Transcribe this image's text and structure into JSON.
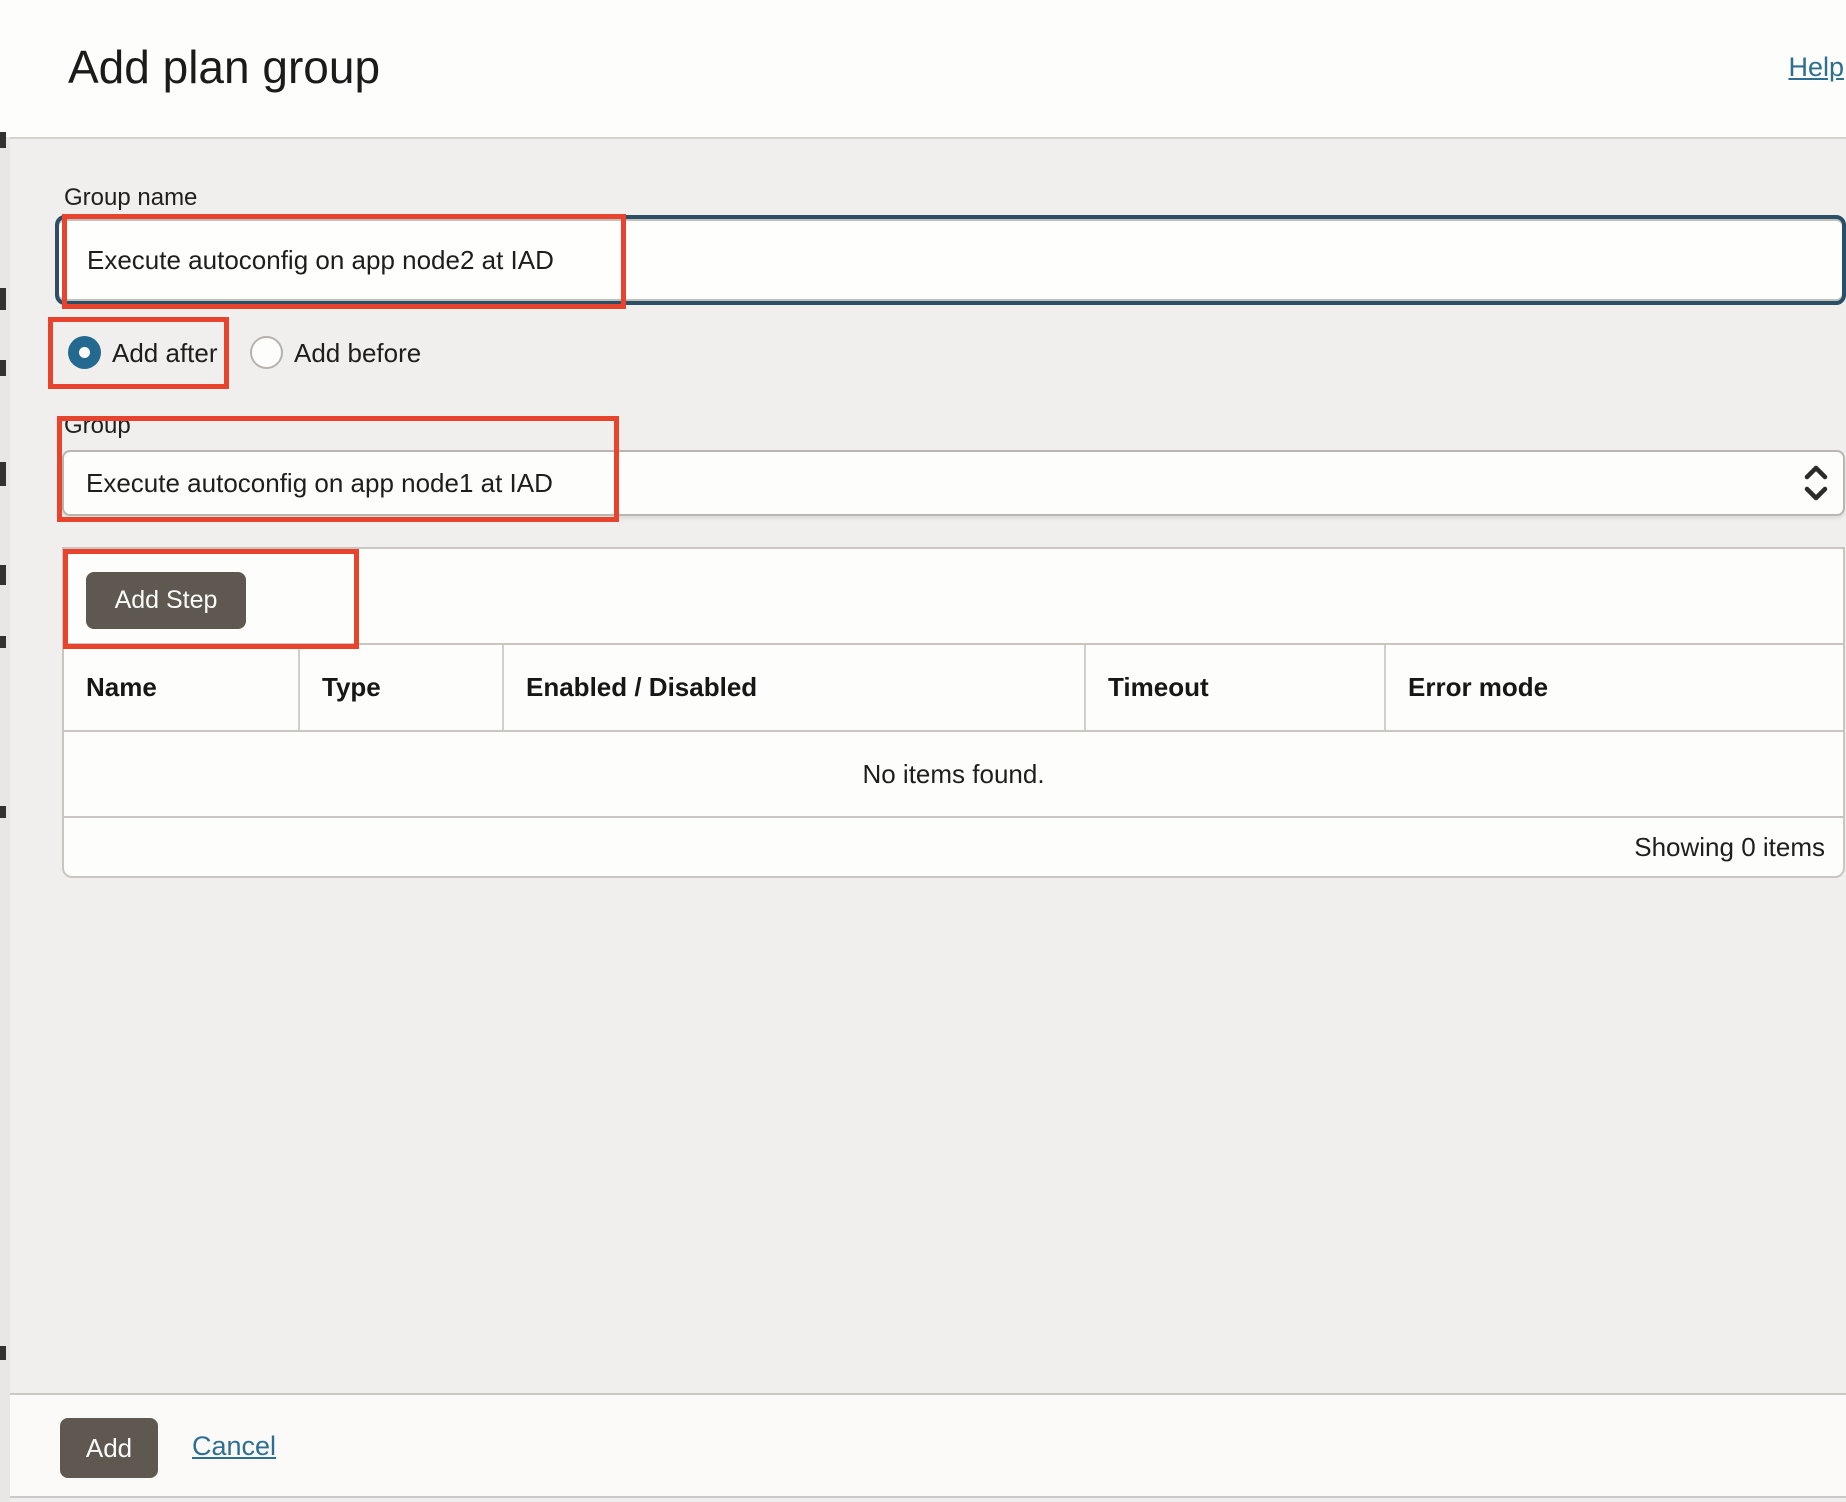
{
  "page": {
    "title": "Add plan group",
    "help_label": "Help"
  },
  "form": {
    "group_name": {
      "label": "Group name",
      "value": "Execute autoconfig on app node2 at IAD"
    },
    "position": {
      "options": [
        {
          "label": "Add after",
          "selected": true
        },
        {
          "label": "Add before",
          "selected": false
        }
      ]
    },
    "group": {
      "label": "Group",
      "value": "Execute autoconfig on app node1 at IAD"
    }
  },
  "steps": {
    "add_step_label": "Add Step",
    "table": {
      "columns": [
        "Name",
        "Type",
        "Enabled / Disabled",
        "Timeout",
        "Error mode"
      ],
      "rows": [],
      "empty_text": "No items found.",
      "summary": "Showing 0 items"
    }
  },
  "footer": {
    "add_label": "Add",
    "cancel_label": "Cancel"
  },
  "colors": {
    "focus_border": "#2b4f66",
    "radio_selected": "#24698f",
    "link": "#2d6f92",
    "dark_button": "#5e5851",
    "annotation": "#e8432c",
    "content_bg": "#f1efed",
    "panel_bg": "#fdfdfb"
  }
}
